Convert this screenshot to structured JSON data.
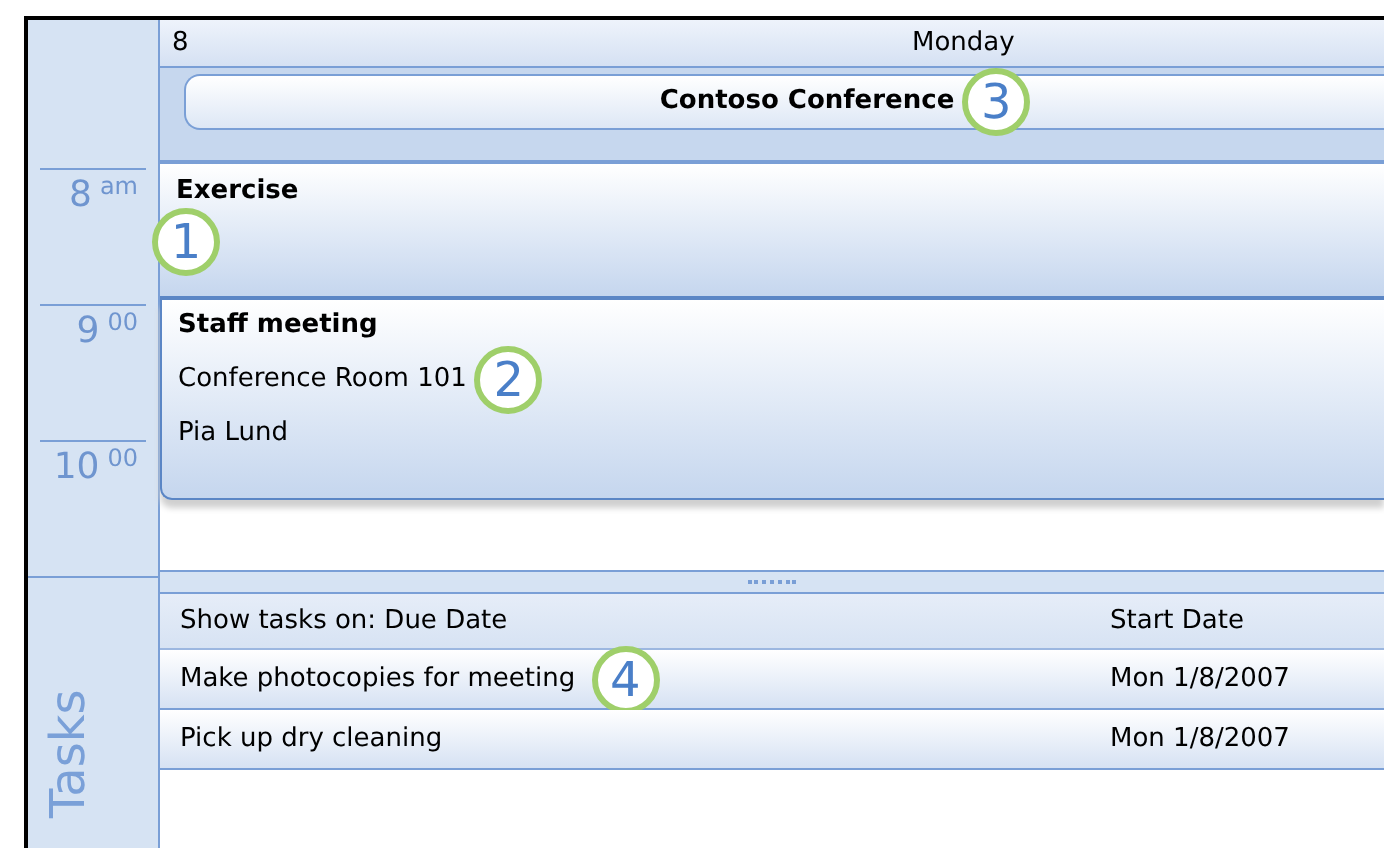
{
  "day": {
    "date": "8",
    "weekday": "Monday"
  },
  "all_day_event": {
    "title": "Contoso Conference",
    "callout": "3"
  },
  "time_slots": [
    {
      "hour": "8",
      "suffix": "am"
    },
    {
      "hour": "9",
      "suffix": "00"
    },
    {
      "hour": "10",
      "suffix": "00"
    }
  ],
  "appointments": [
    {
      "title": "Exercise",
      "callout": "1"
    },
    {
      "title": "Staff meeting",
      "location": "Conference Room 101",
      "organizer": "Pia Lund",
      "callout": "2"
    }
  ],
  "tasks": {
    "label": "Tasks",
    "header": {
      "subject": "Show tasks on: Due Date",
      "date": "Start Date"
    },
    "rows": [
      {
        "subject": "Make photocopies for meeting",
        "date": "Mon 1/8/2007",
        "callout": "4"
      },
      {
        "subject": "Pick up dry cleaning",
        "date": "Mon 1/8/2007"
      }
    ]
  }
}
